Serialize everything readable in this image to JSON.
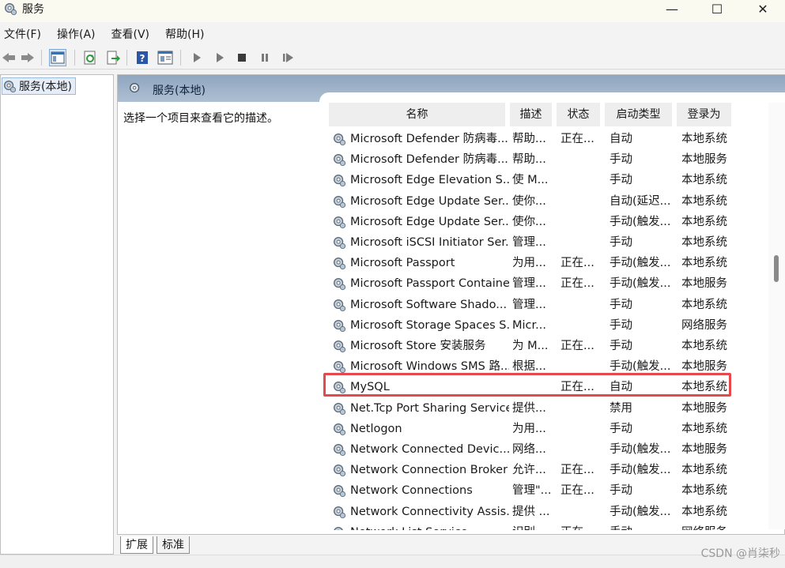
{
  "window": {
    "title": "服务",
    "controls": {
      "minimize": "—",
      "maximize": "☐",
      "close": "✕"
    }
  },
  "menu": [
    "文件(F)",
    "操作(A)",
    "查看(V)",
    "帮助(H)"
  ],
  "toolbar": {
    "icons": [
      "back-icon",
      "forward-icon",
      "show-hide-console-tree-icon",
      "refresh-icon",
      "export-list-icon",
      "help-icon",
      "properties-icon",
      "start-service-icon",
      "start-service-alt-icon",
      "stop-service-icon",
      "pause-service-icon",
      "resume-service-icon"
    ]
  },
  "tree": {
    "root_label": "服务(本地)"
  },
  "pane": {
    "header": "服务(本地)",
    "description": "选择一个项目来查看它的描述。"
  },
  "table": {
    "columns": [
      "名称",
      "描述",
      "状态",
      "启动类型",
      "登录为"
    ],
    "rows": [
      [
        "Microsoft Defender 防病毒...",
        "帮助...",
        "正在...",
        "自动",
        "本地系统"
      ],
      [
        "Microsoft Defender 防病毒...",
        "帮助...",
        "",
        "手动",
        "本地服务"
      ],
      [
        "Microsoft Edge Elevation S...",
        "使 M...",
        "",
        "手动",
        "本地系统"
      ],
      [
        "Microsoft Edge Update Ser...",
        "使你...",
        "",
        "自动(延迟...",
        "本地系统"
      ],
      [
        "Microsoft Edge Update Ser...",
        "使你...",
        "",
        "手动(触发...",
        "本地系统"
      ],
      [
        "Microsoft iSCSI Initiator Ser...",
        "管理...",
        "",
        "手动",
        "本地系统"
      ],
      [
        "Microsoft Passport",
        "为用...",
        "正在...",
        "手动(触发...",
        "本地系统"
      ],
      [
        "Microsoft Passport Container",
        "管理...",
        "正在...",
        "手动(触发...",
        "本地服务"
      ],
      [
        "Microsoft Software Shado...",
        "管理...",
        "",
        "手动",
        "本地系统"
      ],
      [
        "Microsoft Storage Spaces S...",
        "Micr...",
        "",
        "手动",
        "网络服务"
      ],
      [
        "Microsoft Store 安装服务",
        "为 M...",
        "正在...",
        "手动",
        "本地系统"
      ],
      [
        "Microsoft Windows SMS 路...",
        "根据...",
        "",
        "手动(触发...",
        "本地服务"
      ],
      [
        "MySQL",
        "",
        "正在...",
        "自动",
        "本地系统"
      ],
      [
        "Net.Tcp Port Sharing Service",
        "提供...",
        "",
        "禁用",
        "本地服务"
      ],
      [
        "Netlogon",
        "为用...",
        "",
        "手动",
        "本地系统"
      ],
      [
        "Network Connected Devic...",
        "网络...",
        "",
        "手动(触发...",
        "本地服务"
      ],
      [
        "Network Connection Broker",
        "允许...",
        "正在...",
        "手动(触发...",
        "本地系统"
      ],
      [
        "Network Connections",
        "管理\"...",
        "正在...",
        "手动",
        "本地系统"
      ],
      [
        "Network Connectivity Assis...",
        "提供 ...",
        "",
        "手动(触发...",
        "本地系统"
      ],
      [
        "Network List Service",
        "识别...",
        "正在...",
        "手动",
        "网络服务"
      ]
    ],
    "highlighted_row": "MySQL",
    "highlight_color": "#e5484d"
  },
  "tabs": [
    "扩展",
    "标准"
  ],
  "watermark": "CSDN @肖柒秒"
}
